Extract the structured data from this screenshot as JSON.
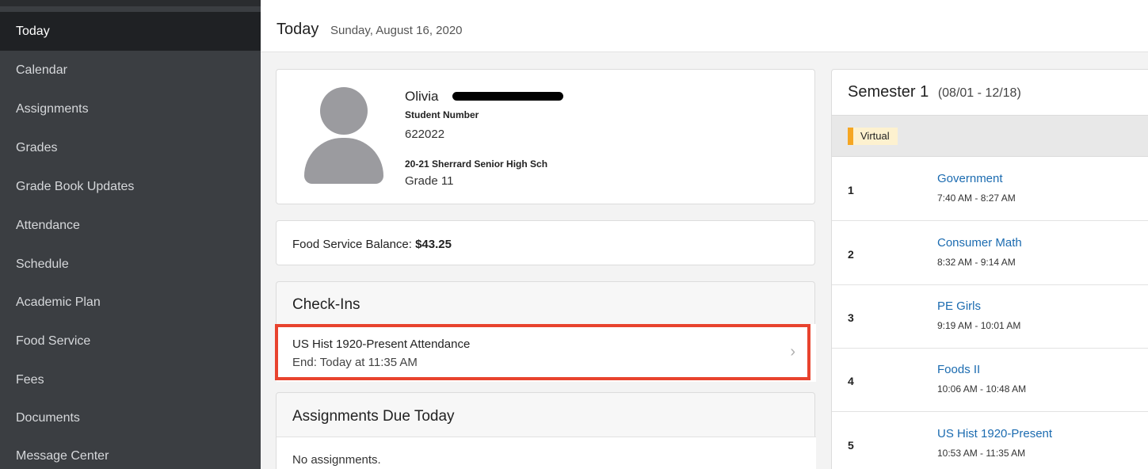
{
  "nav": {
    "items": [
      {
        "label": "Today",
        "active": true
      },
      {
        "label": "Calendar"
      },
      {
        "label": "Assignments"
      },
      {
        "label": "Grades"
      },
      {
        "label": "Grade Book Updates"
      },
      {
        "label": "Attendance"
      },
      {
        "label": "Schedule"
      },
      {
        "label": "Academic Plan"
      },
      {
        "label": "Food Service"
      },
      {
        "label": "Fees"
      },
      {
        "label": "Documents"
      },
      {
        "label": "Message Center"
      }
    ]
  },
  "header": {
    "title": "Today",
    "date": "Sunday, August 16, 2020"
  },
  "profile": {
    "first_name": "Olivia",
    "student_number_label": "Student Number",
    "student_number": "622022",
    "school": "20-21 Sherrard Senior High Sch",
    "grade": "Grade 11"
  },
  "food": {
    "label": "Food Service Balance:",
    "balance": "$43.25"
  },
  "checkins": {
    "title": "Check-Ins",
    "item_title": "US Hist 1920-Present Attendance",
    "item_end": "End: Today at 11:35 AM"
  },
  "assignments": {
    "title": "Assignments Due Today",
    "empty": "No assignments."
  },
  "semester": {
    "title": "Semester 1",
    "range": "(08/01 - 12/18)",
    "badge": "Virtual",
    "periods": [
      {
        "num": "1",
        "name": "Government",
        "time": "7:40 AM - 8:27 AM"
      },
      {
        "num": "2",
        "name": "Consumer Math",
        "time": "8:32 AM - 9:14 AM"
      },
      {
        "num": "3",
        "name": "PE Girls",
        "time": "9:19 AM - 10:01 AM"
      },
      {
        "num": "4",
        "name": "Foods II",
        "time": "10:06 AM - 10:48 AM"
      },
      {
        "num": "5",
        "name": "US Hist 1920-Present",
        "time": "10:53 AM - 11:35 AM"
      }
    ]
  },
  "colors": {
    "sidebar": "#3b3e42",
    "sidebar_active": "#1f2124",
    "link": "#1b6bb0",
    "highlight": "#e8432e",
    "virtual_accent": "#f5a623"
  }
}
